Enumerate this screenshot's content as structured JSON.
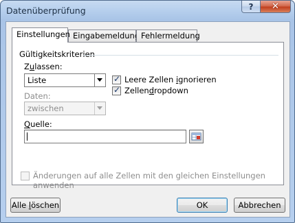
{
  "window": {
    "title": "Datenüberprüfung",
    "help_label": "?",
    "close_label": "✕"
  },
  "tabs": [
    {
      "label": "Einstellungen",
      "active": true
    },
    {
      "label": "Eingabemeldung",
      "active": false
    },
    {
      "label": "Fehlermeldung",
      "active": false
    }
  ],
  "settings": {
    "group_label": "Gültigkeitskriterien",
    "allow": {
      "label_prefix": "Z",
      "label_ul": "u",
      "label_suffix": "lassen:",
      "value": "Liste"
    },
    "data": {
      "label": "Daten:",
      "value": "zwischen",
      "disabled": true
    },
    "ignore_blank": {
      "label_prefix": "Leere Zellen ",
      "label_ul": "i",
      "label_suffix": "gnorieren",
      "checked": true
    },
    "in_cell_dropdown": {
      "label_prefix": "Zellen",
      "label_ul": "d",
      "label_suffix": "ropdown",
      "checked": true
    },
    "source": {
      "label_prefix": "",
      "label_ul": "Q",
      "label_suffix": "uelle:",
      "value": ""
    },
    "apply_all": {
      "label": "Änderungen auf alle Zellen mit den gleichen Einstellungen anwenden",
      "checked": false,
      "disabled": true
    }
  },
  "buttons": {
    "clear_prefix": "Alle ",
    "clear_ul": "l",
    "clear_suffix": "öschen",
    "ok": "OK",
    "cancel": "Abbrechen"
  },
  "icons": {
    "collapse_range": "range-selector-icon",
    "help": "help-icon",
    "close": "close-icon",
    "dropdown": "chevron-down-icon"
  }
}
